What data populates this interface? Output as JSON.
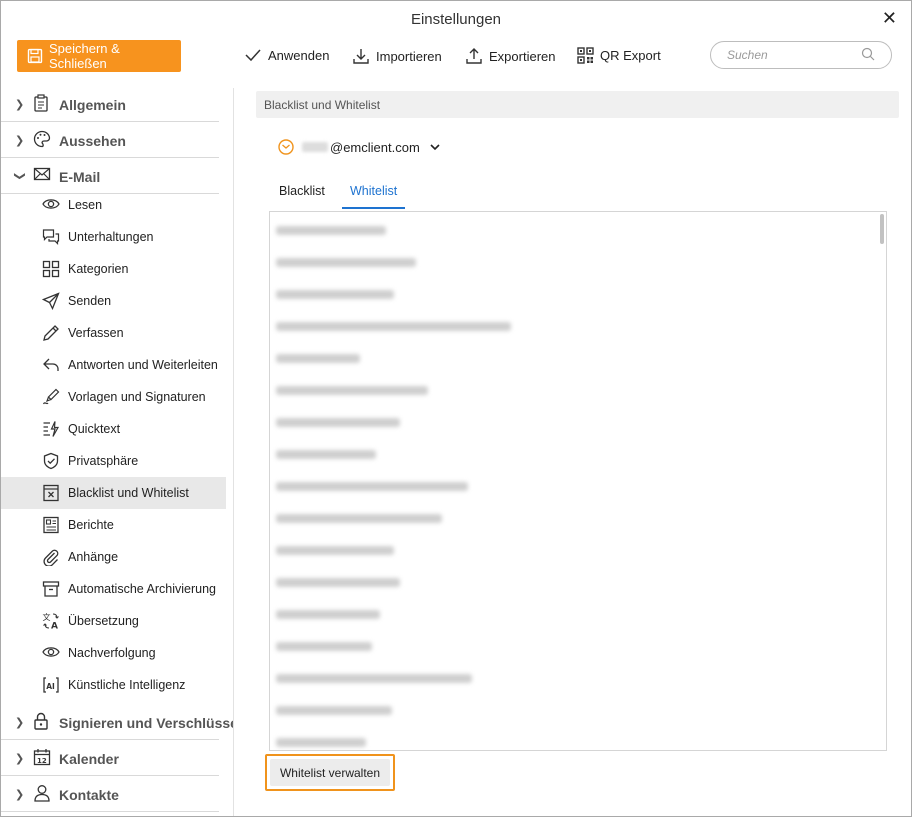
{
  "window": {
    "title": "Einstellungen"
  },
  "toolbar": {
    "save_label": "Speichern & Schließen",
    "apply_label": "Anwenden",
    "import_label": "Importieren",
    "export_label": "Exportieren",
    "qr_label": "QR Export",
    "search_placeholder": "Suchen",
    "accent": "#f7931e"
  },
  "sidebar": {
    "categories": [
      {
        "label": "Allgemein",
        "icon": "clipboard-icon",
        "expanded": false
      },
      {
        "label": "Aussehen",
        "icon": "palette-icon",
        "expanded": false
      },
      {
        "label": "E-Mail",
        "icon": "envelope-icon",
        "expanded": true
      }
    ],
    "email_items": [
      {
        "label": "Lesen",
        "icon": "eye-icon"
      },
      {
        "label": "Unterhaltungen",
        "icon": "conversation-icon"
      },
      {
        "label": "Kategorien",
        "icon": "categories-icon"
      },
      {
        "label": "Senden",
        "icon": "send-icon"
      },
      {
        "label": "Verfassen",
        "icon": "pencil-icon"
      },
      {
        "label": "Antworten und Weiterleiten",
        "icon": "reply-icon"
      },
      {
        "label": "Vorlagen und Signaturen",
        "icon": "signature-pen-icon"
      },
      {
        "label": "Quicktext",
        "icon": "quicktext-icon"
      },
      {
        "label": "Privatsphäre",
        "icon": "shield-icon"
      },
      {
        "label": "Blacklist und Whitelist",
        "icon": "blacklist-icon"
      },
      {
        "label": "Berichte",
        "icon": "report-icon"
      },
      {
        "label": "Anhänge",
        "icon": "paperclip-icon"
      },
      {
        "label": "Automatische Archivierung",
        "icon": "archive-icon"
      },
      {
        "label": "Übersetzung",
        "icon": "translate-icon"
      },
      {
        "label": "Nachverfolgung",
        "icon": "eye-icon"
      },
      {
        "label": "Künstliche Intelligenz",
        "icon": "ai-icon"
      }
    ],
    "active_item": "Blacklist und Whitelist",
    "bottom_categories": [
      {
        "label": "Signieren und Verschlüssel",
        "icon": "lock-icon"
      },
      {
        "label": "Kalender",
        "icon": "calendar-icon"
      },
      {
        "label": "Kontakte",
        "icon": "person-icon"
      }
    ]
  },
  "main": {
    "section_title": "Blacklist und Whitelist",
    "account_email": "@emclient.com",
    "tabs": [
      {
        "label": "Blacklist",
        "active": false
      },
      {
        "label": "Whitelist",
        "active": true
      }
    ],
    "manage_button": "Whitelist verwalten",
    "active_tab_color": "#1e73d0"
  }
}
